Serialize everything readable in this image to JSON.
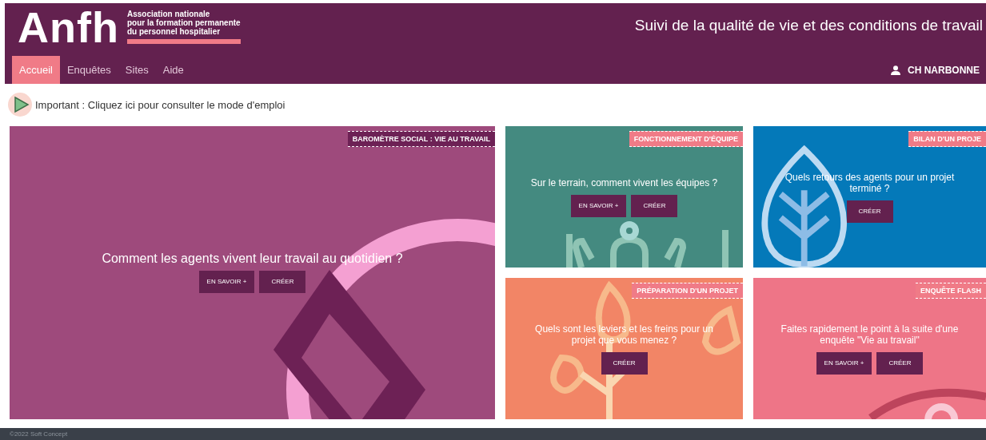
{
  "header": {
    "logo": "Anfh",
    "logo_subtitle": [
      "Association nationale",
      "pour la formation permanente",
      "du personnel hospitalier"
    ],
    "title": "Suivi de la qualité de vie et des conditions de travail"
  },
  "nav": [
    {
      "label": "Accueil",
      "selected": true
    },
    {
      "label": "Enquêtes",
      "selected": false
    },
    {
      "label": "Sites",
      "selected": false
    },
    {
      "label": "Aide",
      "selected": false
    }
  ],
  "user": "CH NARBONNE",
  "notice": "Important : Cliquez ici pour consulter le mode d'emploi",
  "tiles": [
    {
      "kind": "large",
      "color": "#9e4a7c",
      "tag": "BAROMÈTRE SOCIAL : VIE AU TRAVAIL",
      "question": "Comment les agents vivent leur travail au quotidien ?",
      "buttons": [
        "EN SAVOIR +",
        "CRÉER"
      ]
    },
    {
      "kind": "small",
      "color": "#448a80",
      "tag": "FONCTIONNEMENT D'ÉQUIPE",
      "question": "Sur le terrain, comment vivent les équipes ?",
      "buttons": [
        "EN SAVOIR +",
        "CRÉER"
      ]
    },
    {
      "kind": "small",
      "color": "#0479b9",
      "tag": "BILAN D'UN PROJE",
      "question": "Quels retours des agents pour un projet terminé ?",
      "buttons": [
        "CRÉER"
      ]
    },
    {
      "kind": "small",
      "color": "#f28566",
      "tag": "PRÉPARATION D'UN PROJET",
      "question": "Quels sont les leviers et les freins pour un projet que vous menez ?",
      "buttons": [
        "CRÉER"
      ]
    },
    {
      "kind": "small",
      "color": "#ee7587",
      "tag": "ENQUÊTE FLASH",
      "question": "Faites rapidement le point à la suite d'une enquête \"Vie au travail\"",
      "buttons": [
        "EN SAVOIR +",
        "CRÉER"
      ]
    }
  ],
  "footer": "©2022 Soft Concept"
}
